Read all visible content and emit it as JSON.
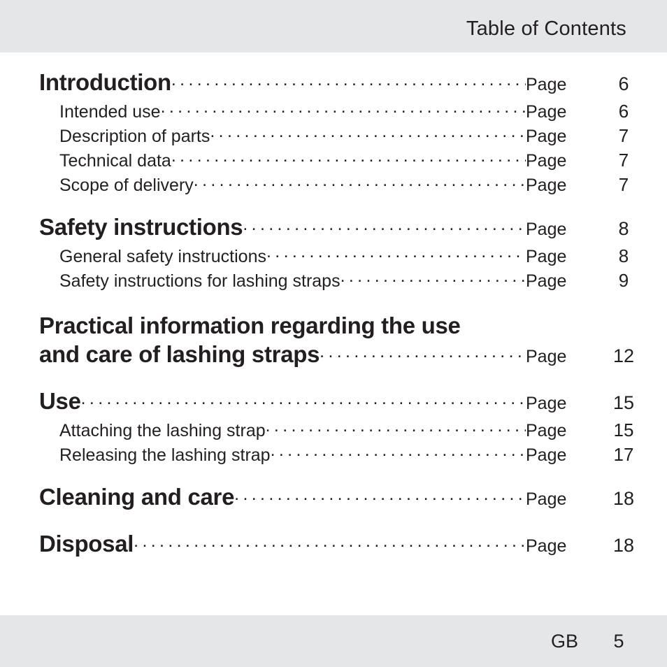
{
  "header": {
    "title": "Table of Contents",
    "band_color": "#e4e6e8"
  },
  "footer": {
    "language_code": "GB",
    "page_number": "5",
    "band_color": "#e4e6e8"
  },
  "page_label": "Page",
  "toc": {
    "groups": [
      {
        "heading": {
          "title": "Introduction",
          "title_line2": "",
          "page_label": "Page",
          "page": "6"
        },
        "subentries": [
          {
            "title": "Intended use",
            "page_label": "Page",
            "page": "6"
          },
          {
            "title": "Description of parts",
            "page_label": "Page",
            "page": "7"
          },
          {
            "title": "Technical data",
            "page_label": "Page",
            "page": "7"
          },
          {
            "title": "Scope of delivery",
            "page_label": "Page",
            "page": "7"
          }
        ]
      },
      {
        "heading": {
          "title": "Safety instructions",
          "title_line2": "",
          "page_label": "Page",
          "page": "8"
        },
        "subentries": [
          {
            "title": "General safety instructions",
            "page_label": "Page",
            "page": "8"
          },
          {
            "title": "Safety instructions for lashing straps",
            "page_label": "Page",
            "page": "9"
          }
        ]
      },
      {
        "heading": {
          "title": "Practical information regarding the use",
          "title_line2": "and care of lashing straps",
          "page_label": "Page",
          "page": "12"
        },
        "subentries": []
      },
      {
        "heading": {
          "title": "Use",
          "title_line2": "",
          "page_label": "Page",
          "page": "15"
        },
        "subentries": [
          {
            "title": "Attaching the lashing strap",
            "page_label": "Page",
            "page": "15"
          },
          {
            "title": "Releasing the lashing strap",
            "page_label": "Page",
            "page": "17"
          }
        ]
      },
      {
        "heading": {
          "title": "Cleaning and care",
          "title_line2": "",
          "page_label": "Page",
          "page": "18"
        },
        "subentries": []
      },
      {
        "heading": {
          "title": "Disposal",
          "title_line2": "",
          "page_label": "Page",
          "page": "18"
        },
        "subentries": []
      }
    ]
  }
}
